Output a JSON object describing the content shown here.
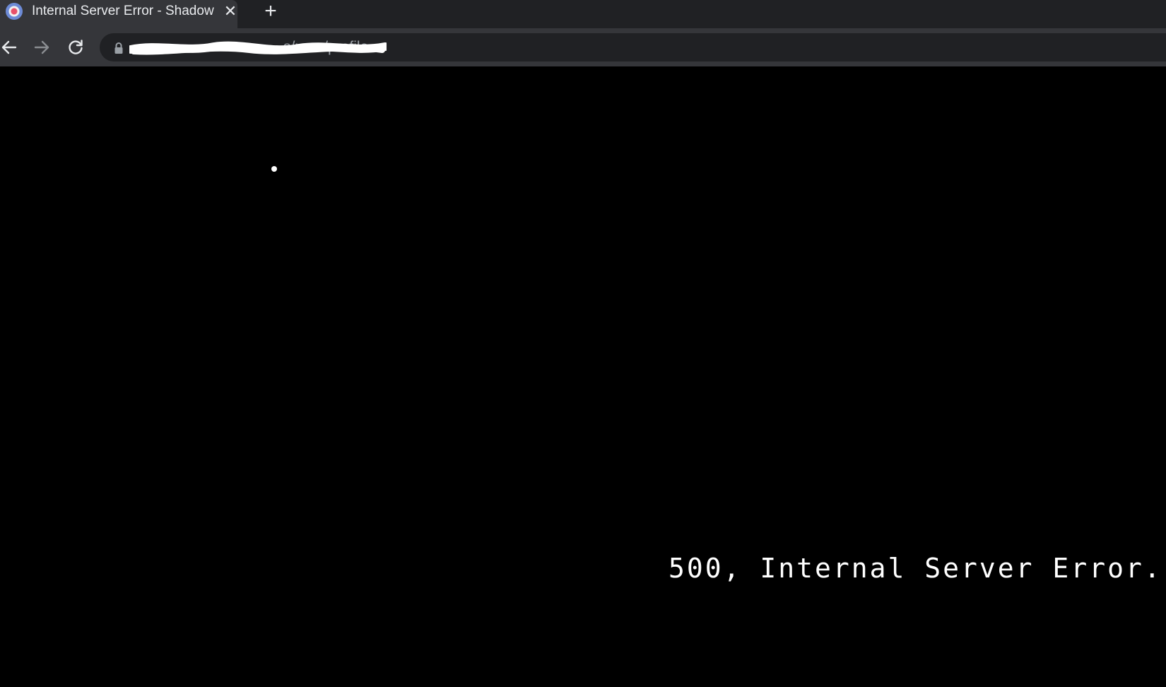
{
  "browser": {
    "tab": {
      "title": "Internal Server Error - Shadow",
      "close_glyph": "✕",
      "favicon": "site-favicon"
    },
    "new_tab_glyph": "+",
    "toolbar": {
      "back_icon": "back-arrow-icon",
      "forward_icon": "forward-arrow-icon",
      "reload_icon": "reload-icon",
      "lock_icon": "lock-icon"
    },
    "address_bar": {
      "visible_url_suffix": "s/user/profile",
      "redacted": true
    },
    "colors": {
      "tabstrip_bg": "#202124",
      "active_tab_bg": "#35363a",
      "omnibox_bg": "#202124",
      "url_text": "#9aa0a6",
      "page_bg": "#000000",
      "page_text": "#ffffff"
    }
  },
  "page": {
    "error_message": "500, Internal Server Error."
  }
}
